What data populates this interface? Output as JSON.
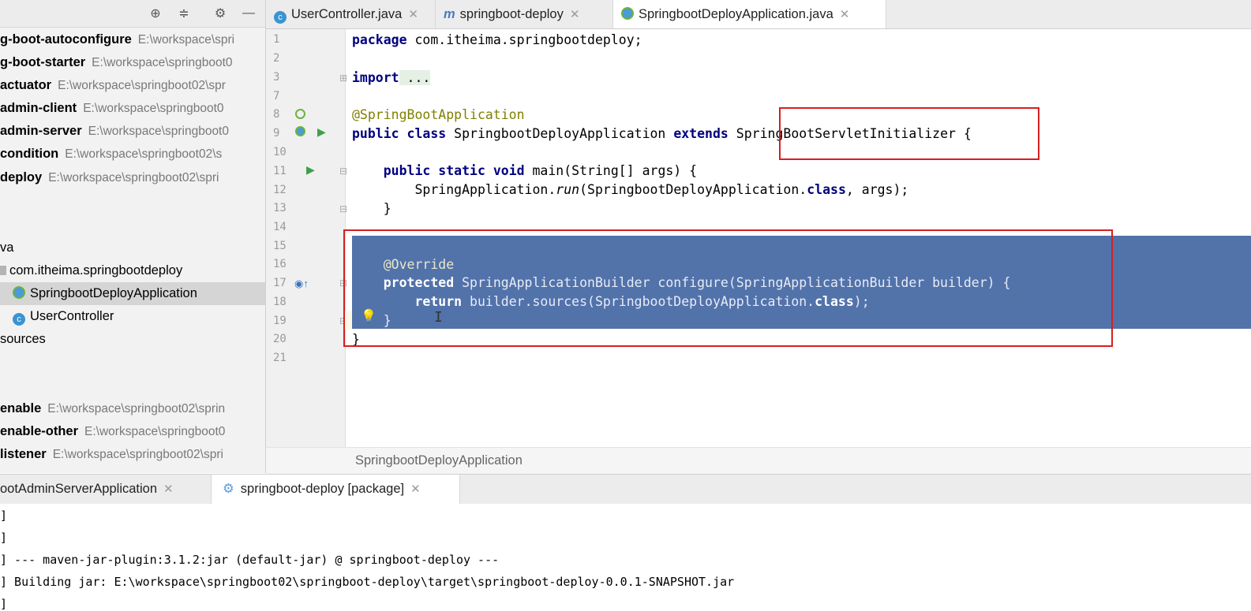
{
  "project_panel": {
    "modules": [
      {
        "name": "g-boot-autoconfigure",
        "path": "E:\\workspace\\spri"
      },
      {
        "name": "g-boot-starter",
        "path": "E:\\workspace\\springboot0"
      },
      {
        "name": "actuator",
        "path": "E:\\workspace\\springboot02\\spr"
      },
      {
        "name": "admin-client",
        "path": "E:\\workspace\\springboot0"
      },
      {
        "name": "admin-server",
        "path": "E:\\workspace\\springboot0"
      },
      {
        "name": "condition",
        "path": "E:\\workspace\\springboot02\\s"
      },
      {
        "name": "deploy",
        "path": "E:\\workspace\\springboot02\\spri"
      }
    ],
    "java_folder": "va",
    "package": "com.itheima.springbootdeploy",
    "classes": [
      "SpringbootDeployApplication",
      "UserController"
    ],
    "resources_folder": "sources",
    "modules_bottom": [
      {
        "name": "enable",
        "path": "E:\\workspace\\springboot02\\sprin"
      },
      {
        "name": "enable-other",
        "path": "E:\\workspace\\springboot0"
      },
      {
        "name": "listener",
        "path": "E:\\workspace\\springboot02\\spri"
      }
    ]
  },
  "editor_tabs": [
    {
      "label": "UserController.java",
      "icon": "class-icon"
    },
    {
      "label": "springboot-deploy",
      "icon": "maven-icon"
    },
    {
      "label": "SpringbootDeployApplication.java",
      "icon": "spring-boot-icon",
      "active": true
    }
  ],
  "code": {
    "line_numbers": [
      "1",
      "2",
      "3",
      "7",
      "8",
      "9",
      "10",
      "11",
      "12",
      "13",
      "14",
      "15",
      "16",
      "17",
      "18",
      "19",
      "20",
      "21"
    ],
    "l1_kw": "package",
    "l1_rest": " com.itheima.springbootdeploy;",
    "l3_kw": "import",
    "l3_rest": " ...",
    "l8": "@SpringBootApplication",
    "l9_kw1": "public class",
    "l9_mid": " SpringbootDeployApplication ",
    "l9_kw2": "extends",
    "l9_sp": " ",
    "l9_super": "SpringBootServletInitializer",
    "l9_end": " {",
    "l11_kw": "public static void",
    "l11_rest": " main(String[] args) {",
    "l12_a": "SpringApplication.",
    "l12_run": "run",
    "l12_b": "(SpringbootDeployApplication.",
    "l12_cls": "class",
    "l12_c": ", args);",
    "l13": "}",
    "l16": "@Override",
    "l17_kw": "protected",
    "l17_rest": " SpringApplicationBuilder configure(SpringApplicationBuilder builder) {",
    "l18_kw": "return",
    "l18_mid": " builder.sources(SpringbootDeployApplication.",
    "l18_cls": "class",
    "l18_end": ");",
    "l19": "}",
    "l20": "}"
  },
  "breadcrumb": "SpringbootDeployApplication",
  "run_tabs": [
    {
      "label": "ootAdminServerApplication"
    },
    {
      "label": "springboot-deploy [package]",
      "active": true
    }
  ],
  "console_lines": [
    "]",
    "]",
    "] --- maven-jar-plugin:3.1.2:jar (default-jar) @ springboot-deploy ---",
    "] Building jar: E:\\workspace\\springboot02\\springboot-deploy\\target\\springboot-deploy-0.0.1-SNAPSHOT.jar",
    "]"
  ],
  "colors": {
    "selection": "#5272aa",
    "highlight_box": "#d81e1e",
    "keyword": "#000080",
    "annotation": "#808000"
  }
}
